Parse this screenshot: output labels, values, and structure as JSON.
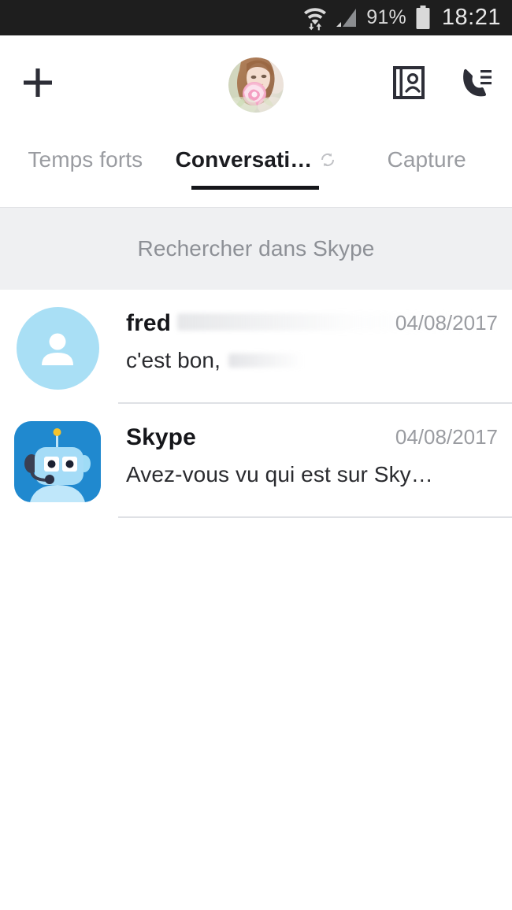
{
  "status_bar": {
    "wifi_icon": "wifi-with-transfer-arrows-icon",
    "signal_icon": "cellular-signal-icon",
    "battery_percent": "91%",
    "battery_icon": "battery-icon",
    "clock": "18:21",
    "background_color": "#1e1e1e",
    "text_color": "#d9d9d9"
  },
  "app_bar": {
    "add_icon": "plus-icon",
    "profile_avatar": "user-profile-photo-avatar",
    "contacts_icon": "address-book-contacts-icon",
    "call_history_icon": "phone-call-list-icon"
  },
  "tabs": [
    {
      "label": "Temps forts",
      "active": false
    },
    {
      "label": "Conversati…",
      "active": true,
      "sync_icon": "sync-refresh-icon"
    },
    {
      "label": "Capture",
      "active": false
    }
  ],
  "tab_underline_color": "#15161a",
  "search": {
    "placeholder": "Rechercher dans Skype",
    "background_color": "#eff0f2",
    "text_color": "#8d9096"
  },
  "conversations": [
    {
      "name": "fred",
      "message": "c'est bon,",
      "date": "04/08/2017",
      "avatar_type": "default-person-avatar",
      "avatar_color": "#a9dff5"
    },
    {
      "name": "Skype",
      "message": "Avez-vous vu qui est sur Sky…",
      "date": "04/08/2017",
      "avatar_type": "skype-bot-avatar",
      "avatar_color": "#1a85cc"
    }
  ],
  "colors": {
    "accent_blue": "#1a85cc",
    "light_blue": "#a9dff5",
    "text_primary": "#15161a",
    "text_secondary": "#9a9ca1",
    "divider": "#dfe1e5",
    "page_background": "#ffffff"
  }
}
